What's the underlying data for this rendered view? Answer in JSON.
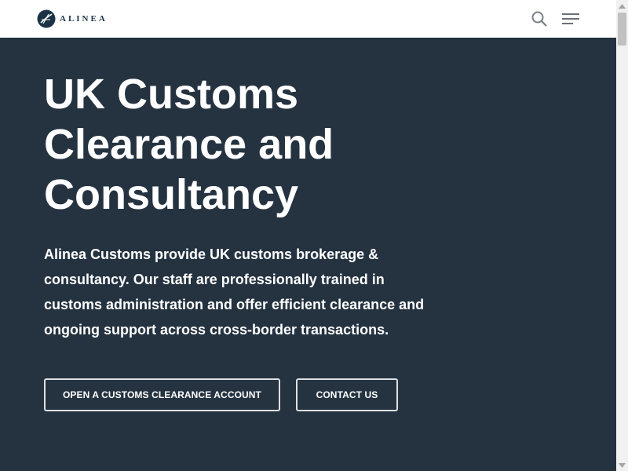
{
  "header": {
    "logo_text": "ALINEA",
    "logo_color": "#1c3347",
    "search_icon": "search-icon",
    "menu_icon": "hamburger-menu-icon"
  },
  "hero": {
    "background_color": "#253341",
    "title": "UK Customs Clearance and Consultancy",
    "description": "Alinea Customs provide UK customs brokerage & consultancy. Our staff are professionally trained in customs administration and offer efficient clearance and ongoing support across cross-border transactions.",
    "buttons": [
      {
        "label": "OPEN A CUSTOMS CLEARANCE ACCOUNT"
      },
      {
        "label": "CONTACT US"
      }
    ]
  }
}
